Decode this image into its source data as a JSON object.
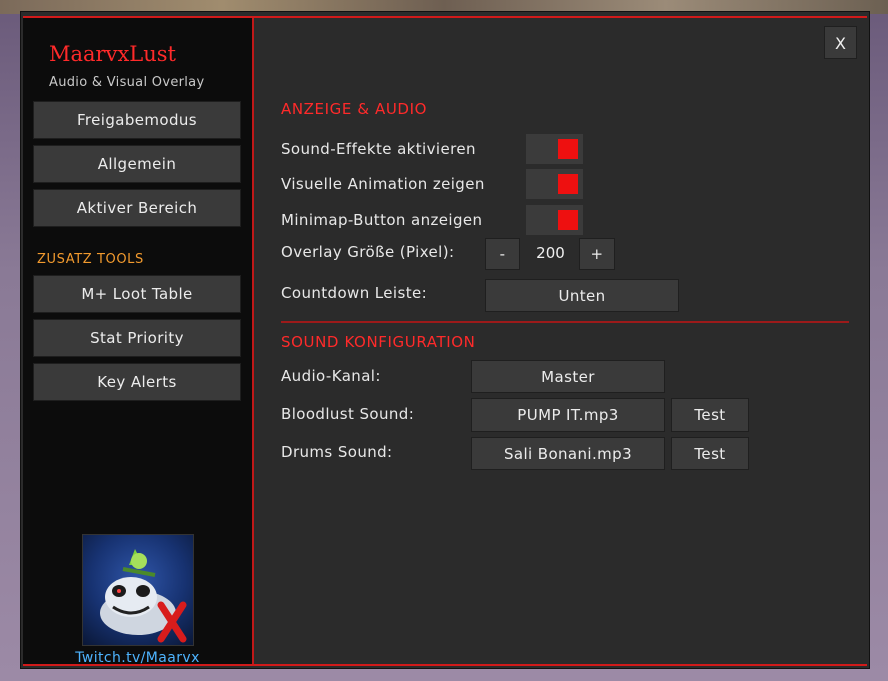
{
  "app": {
    "title": "MaarvxLust",
    "subtitle": "Audio & Visual Overlay",
    "close_label": "X"
  },
  "sidebar": {
    "items": [
      {
        "label": "Freigabemodus"
      },
      {
        "label": "Allgemein"
      },
      {
        "label": "Aktiver Bereich"
      }
    ],
    "tools_heading": "ZUSATZ TOOLS",
    "tools": [
      {
        "label": "M+ Loot Table"
      },
      {
        "label": "Stat Priority"
      },
      {
        "label": "Key Alerts"
      }
    ],
    "twitch_link": "Twitch.tv/Maarvx"
  },
  "display_audio": {
    "heading": "ANZEIGE & AUDIO",
    "options": [
      {
        "label": "Sound-Effekte aktivieren",
        "enabled": true
      },
      {
        "label": "Visuelle Animation zeigen",
        "enabled": true
      },
      {
        "label": "Minimap-Button anzeigen",
        "enabled": true
      }
    ],
    "overlay_size": {
      "label": "Overlay Größe (Pixel):",
      "value": "200",
      "minus": "-",
      "plus": "+"
    },
    "countdown": {
      "label": "Countdown Leiste:",
      "value": "Unten"
    }
  },
  "sound_config": {
    "heading": "SOUND KONFIGURATION",
    "audio_channel": {
      "label": "Audio-Kanal:",
      "value": "Master"
    },
    "bloodlust": {
      "label": "Bloodlust Sound:",
      "value": "PUMP IT.mp3",
      "test": "Test"
    },
    "drums": {
      "label": "Drums Sound:",
      "value": "Sali Bonani.mp3",
      "test": "Test"
    }
  },
  "colors": {
    "accent_red": "#ff2a2a",
    "toggle_on": "#ee1010",
    "tools_orange": "#f29a2e",
    "link_blue": "#4eb4ff",
    "panel_bg": "#2b2b2b",
    "sidebar_bg": "#0c0c0c"
  }
}
